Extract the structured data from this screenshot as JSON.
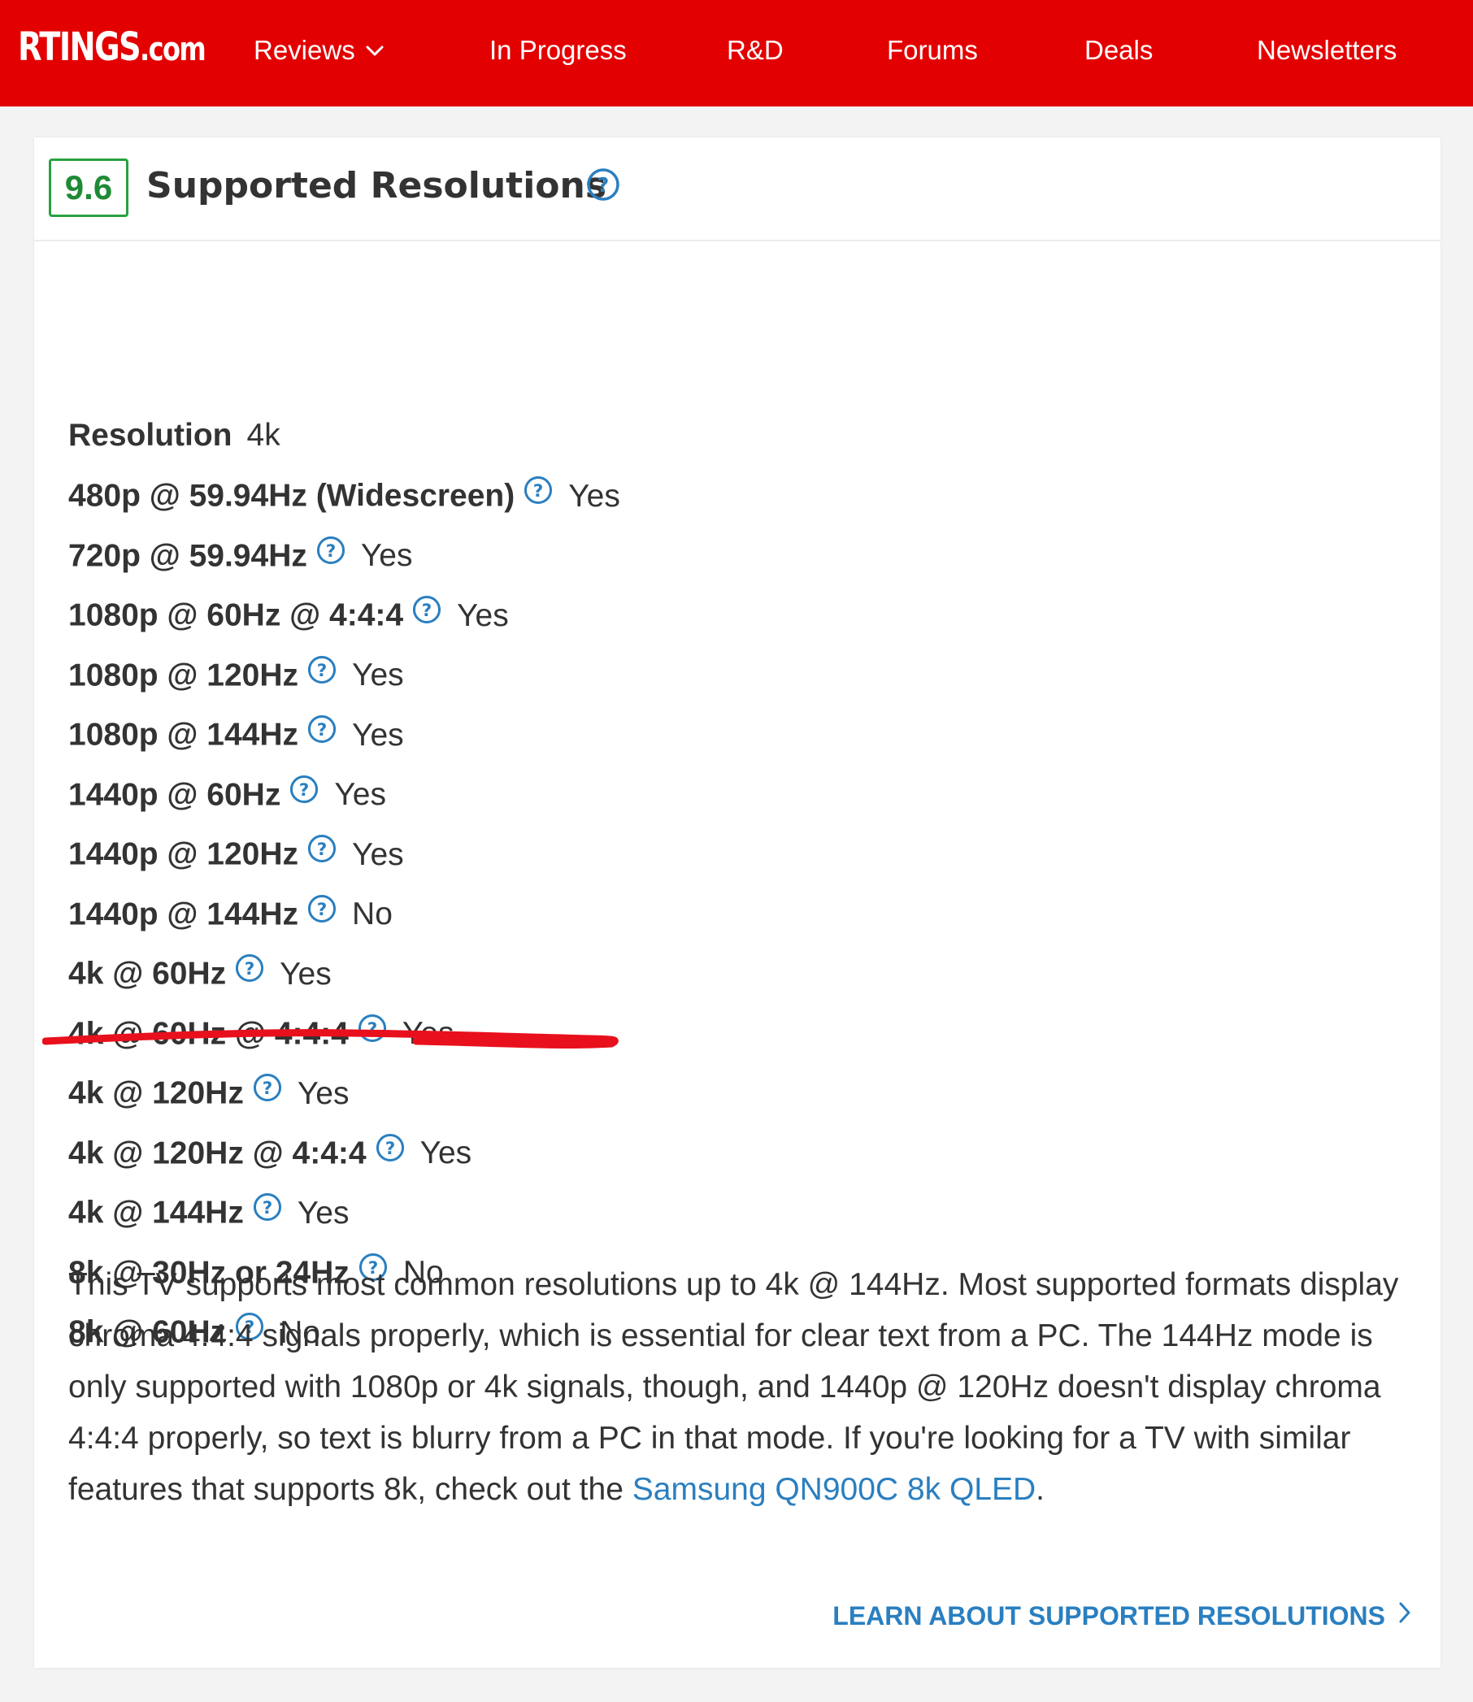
{
  "nav": {
    "logo_main": "RTINGS",
    "logo_suffix": ".com",
    "items": [
      {
        "label": "Reviews"
      },
      {
        "label": "In Progress"
      },
      {
        "label": "R&D"
      },
      {
        "label": "Forums"
      },
      {
        "label": "Deals"
      },
      {
        "label": "Newsletters"
      }
    ]
  },
  "section": {
    "score": "9.6",
    "title": "Supported Resolutions",
    "resolution_label": "Resolution",
    "resolution_value": "4k",
    "rows": [
      {
        "label": "480p @ 59.94Hz (Widescreen)",
        "value": "Yes"
      },
      {
        "label": "720p @ 59.94Hz",
        "value": "Yes"
      },
      {
        "label": "1080p @ 60Hz @ 4:4:4",
        "value": "Yes"
      },
      {
        "label": "1080p @ 120Hz",
        "value": "Yes"
      },
      {
        "label": "1080p @ 144Hz",
        "value": "Yes"
      },
      {
        "label": "1440p @ 60Hz",
        "value": "Yes"
      },
      {
        "label": "1440p @ 120Hz",
        "value": "Yes"
      },
      {
        "label": "1440p @ 144Hz",
        "value": "No"
      },
      {
        "label": "4k @ 60Hz",
        "value": "Yes"
      },
      {
        "label": "4k @ 60Hz @ 4:4:4",
        "value": "Yes"
      },
      {
        "label": "4k @ 120Hz",
        "value": "Yes"
      },
      {
        "label": "4k @ 120Hz @ 4:4:4",
        "value": "Yes"
      },
      {
        "label": "4k @ 144Hz",
        "value": "Yes"
      },
      {
        "label": "8k @ 30Hz or 24Hz",
        "value": "No"
      },
      {
        "label": "8k @ 60Hz",
        "value": "No"
      }
    ],
    "description_text": "This TV supports most common resolutions up to 4k @ 144Hz. Most supported formats display chroma 4:4:4 signals properly, which is essential for clear text from a PC. The 144Hz mode is only supported with 1080p or 4k signals, though, and 1440p @ 120Hz doesn't display chroma 4:4:4 properly, so text is blurry from a PC in that mode. If you're looking for a TV with similar features that supports 8k, check out the ",
    "description_link": "Samsung QN900C 8k QLED",
    "description_end": ".",
    "learn_more": "LEARN ABOUT SUPPORTED RESOLUTIONS"
  },
  "colors": {
    "nav_bg": "#e30000",
    "score_green": "#27a140",
    "link_blue": "#2a7fc0",
    "annotation_red": "#e8101c"
  }
}
